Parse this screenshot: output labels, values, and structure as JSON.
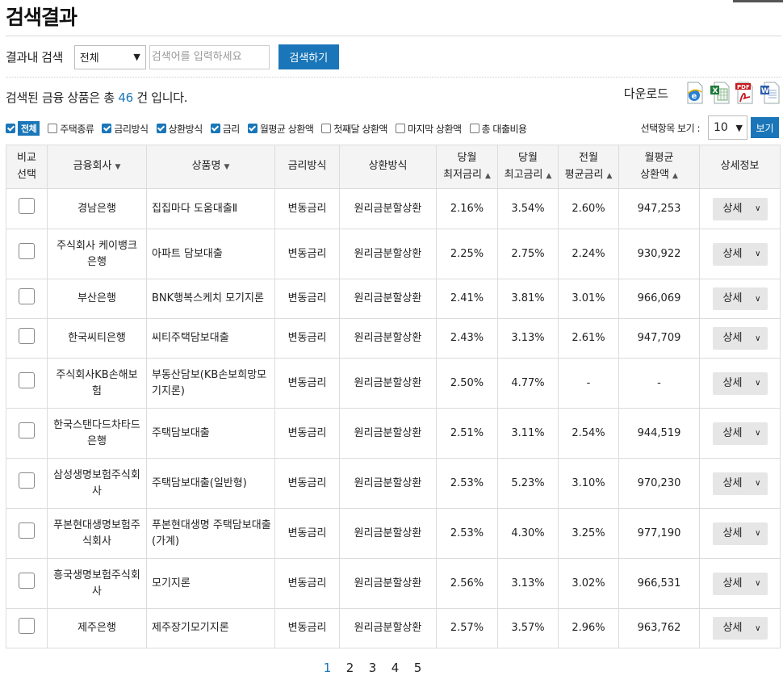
{
  "page": {
    "title": "검색결과"
  },
  "search": {
    "label": "결과내 검색",
    "scope_value": "전체",
    "placeholder": "검색어를 입력하세요",
    "button": "검색하기"
  },
  "summary": {
    "prefix": "검색된 금융 상품은 총 ",
    "count": "46",
    "suffix": " 건 입니다."
  },
  "download": {
    "label": "다운로드",
    "icons": [
      "ie-icon",
      "excel-icon",
      "pdf-icon",
      "word-icon"
    ]
  },
  "options": {
    "all": {
      "label": "전체",
      "checked": true
    },
    "items": [
      {
        "label": "주택종류",
        "checked": false
      },
      {
        "label": "금리방식",
        "checked": true
      },
      {
        "label": "상환방식",
        "checked": true
      },
      {
        "label": "금리",
        "checked": true
      },
      {
        "label": "월평균 상환액",
        "checked": true
      },
      {
        "label": "첫째달 상환액",
        "checked": false
      },
      {
        "label": "마지막 상환액",
        "checked": false
      },
      {
        "label": "총 대출비용",
        "checked": false
      }
    ],
    "perpage_label": "선택항목 보기 :",
    "perpage_value": "10",
    "perpage_button": "보기"
  },
  "table": {
    "headers": [
      {
        "lines": [
          "비교",
          "선택"
        ],
        "sort": ""
      },
      {
        "lines": [
          "금융회사"
        ],
        "sort": "▼"
      },
      {
        "lines": [
          "상품명"
        ],
        "sort": "▼"
      },
      {
        "lines": [
          "금리방식"
        ],
        "sort": ""
      },
      {
        "lines": [
          "상환방식"
        ],
        "sort": ""
      },
      {
        "lines": [
          "당월",
          "최저금리"
        ],
        "sort": "▲"
      },
      {
        "lines": [
          "당월",
          "최고금리"
        ],
        "sort": "▲"
      },
      {
        "lines": [
          "전월",
          "평균금리"
        ],
        "sort": "▲"
      },
      {
        "lines": [
          "월평균",
          "상환액"
        ],
        "sort": "▲"
      },
      {
        "lines": [
          "상세정보"
        ],
        "sort": ""
      }
    ],
    "detail_label": "상세",
    "rows": [
      {
        "company": [
          "경남은행"
        ],
        "product": [
          "집집마다 도움대출Ⅱ"
        ],
        "rate_type": "변동금리",
        "repay": "원리금분할상환",
        "min": "2.16%",
        "max": "3.54%",
        "avg": "2.60%",
        "monthly": "947,253"
      },
      {
        "company": [
          "주식회사 케이뱅크",
          "은행"
        ],
        "product": [
          "아파트 담보대출"
        ],
        "rate_type": "변동금리",
        "repay": "원리금분할상환",
        "min": "2.25%",
        "max": "2.75%",
        "avg": "2.24%",
        "monthly": "930,922"
      },
      {
        "company": [
          "부산은행"
        ],
        "product": [
          "BNK행복스케치 모기지론"
        ],
        "rate_type": "변동금리",
        "repay": "원리금분할상환",
        "min": "2.41%",
        "max": "3.81%",
        "avg": "3.01%",
        "monthly": "966,069"
      },
      {
        "company": [
          "한국씨티은행"
        ],
        "product": [
          "씨티주택담보대출"
        ],
        "rate_type": "변동금리",
        "repay": "원리금분할상환",
        "min": "2.43%",
        "max": "3.13%",
        "avg": "2.61%",
        "monthly": "947,709"
      },
      {
        "company": [
          "주식회사KB손해보",
          "험"
        ],
        "product": [
          "부동산담보(KB손보희망모",
          "기지론)"
        ],
        "rate_type": "변동금리",
        "repay": "원리금분할상환",
        "min": "2.50%",
        "max": "4.77%",
        "avg": "-",
        "monthly": "-"
      },
      {
        "company": [
          "한국스탠다드차타드",
          "은행"
        ],
        "product": [
          "주택담보대출"
        ],
        "rate_type": "변동금리",
        "repay": "원리금분할상환",
        "min": "2.51%",
        "max": "3.11%",
        "avg": "2.54%",
        "monthly": "944,519"
      },
      {
        "company": [
          "삼성생명보험주식회",
          "사"
        ],
        "product": [
          "주택담보대출(일반형)"
        ],
        "rate_type": "변동금리",
        "repay": "원리금분할상환",
        "min": "2.53%",
        "max": "5.23%",
        "avg": "3.10%",
        "monthly": "970,230"
      },
      {
        "company": [
          "푸본현대생명보험주",
          "식회사"
        ],
        "product": [
          "푸본현대생명 주택담보대출",
          "(가계)"
        ],
        "rate_type": "변동금리",
        "repay": "원리금분할상환",
        "min": "2.53%",
        "max": "4.30%",
        "avg": "3.25%",
        "monthly": "977,190"
      },
      {
        "company": [
          "흥국생명보험주식회",
          "사"
        ],
        "product": [
          "모기지론"
        ],
        "rate_type": "변동금리",
        "repay": "원리금분할상환",
        "min": "2.56%",
        "max": "3.13%",
        "avg": "3.02%",
        "monthly": "966,531"
      },
      {
        "company": [
          "제주은행"
        ],
        "product": [
          "제주장기모기지론"
        ],
        "rate_type": "변동금리",
        "repay": "원리금분할상환",
        "min": "2.57%",
        "max": "3.57%",
        "avg": "2.96%",
        "monthly": "963,762"
      }
    ]
  },
  "pagination": {
    "pages": [
      "1",
      "2",
      "3",
      "4",
      "5"
    ],
    "current": "1"
  },
  "colors": {
    "accent": "#1a76b8",
    "header_bg": "#f4f4f4",
    "border": "#dcdcdc"
  }
}
